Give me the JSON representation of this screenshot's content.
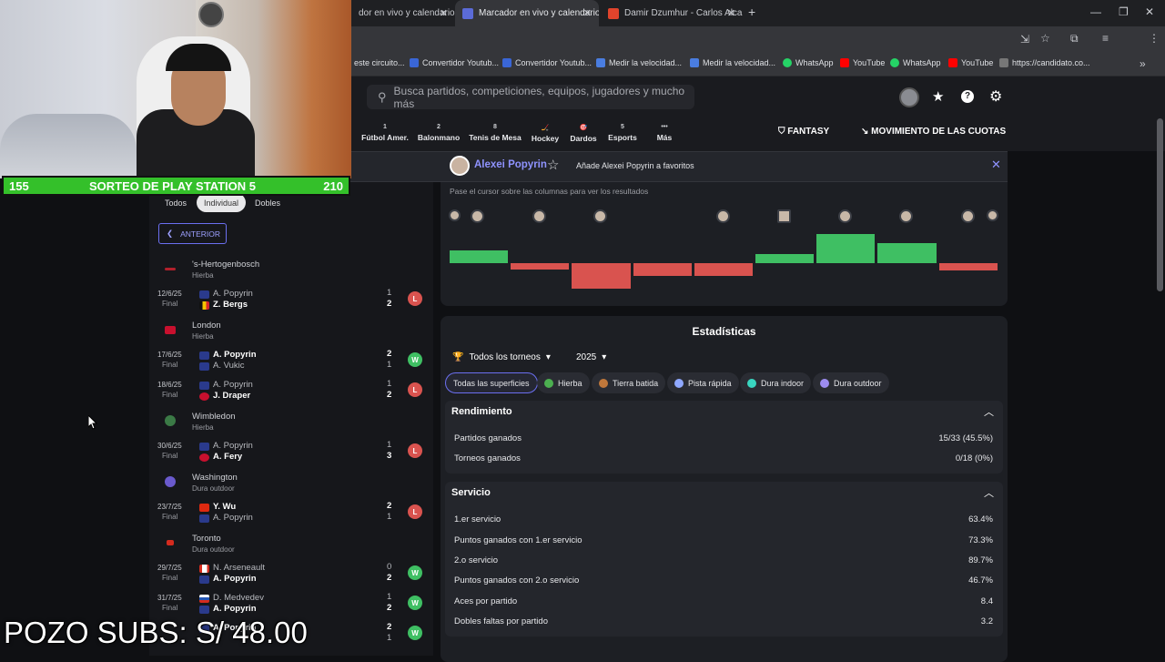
{
  "browser": {
    "tabs": [
      {
        "title": "dor en vivo y calendario",
        "active": false
      },
      {
        "title": "Marcador en vivo y calendario",
        "active": true
      },
      {
        "title": "Damir Dzumhur - Carlos Alcara",
        "active": false
      }
    ],
    "bookmarks": [
      {
        "label": "este circuito...",
        "color": "#35363a"
      },
      {
        "label": "Convertidor Youtub...",
        "color": "#3a66d6"
      },
      {
        "label": "Convertidor Youtub...",
        "color": "#3a66d6"
      },
      {
        "label": "Medir la velocidad...",
        "color": "#4a7de0"
      },
      {
        "label": "Medir la velocidad...",
        "color": "#4a7de0"
      },
      {
        "label": "WhatsApp",
        "color": "#25d366"
      },
      {
        "label": "YouTube",
        "color": "#ff0000"
      },
      {
        "label": "WhatsApp",
        "color": "#25d366"
      },
      {
        "label": "YouTube",
        "color": "#ff0000"
      },
      {
        "label": "https://candidato.co...",
        "color": "#777"
      }
    ]
  },
  "header": {
    "search_placeholder": "Busca partidos, competiciones, equipos, jugadores y mucho más",
    "sports": [
      {
        "num": "1",
        "label": "Fútbol Amer."
      },
      {
        "num": "2",
        "label": "Balonmano"
      },
      {
        "num": "8",
        "label": "Tenis de Mesa"
      },
      {
        "num": "",
        "label": "Hockey"
      },
      {
        "num": "",
        "label": "Dardos"
      },
      {
        "num": "5",
        "label": "Esports"
      },
      {
        "num": "",
        "label": "Más"
      }
    ],
    "fantasy": "FANTASY",
    "odds": "MOVIMIENTO DE LAS CUOTAS"
  },
  "banner": {
    "player": "Alexei Popyrin",
    "fav_text": "Añade Alexei Popyrin a favoritos"
  },
  "filters": {
    "all": "Todos",
    "singles": "Individual",
    "doubles": "Dobles"
  },
  "back_label": "ANTERIOR",
  "matches": {
    "t1": {
      "name": "'s-Hertogenbosch",
      "surface": "Hierba"
    },
    "m1": {
      "date": "12/6/25",
      "status": "Final",
      "p1": "A. Popyrin",
      "p2": "Z. Bergs",
      "s1": "1",
      "s2": "2",
      "result": "L"
    },
    "t2": {
      "name": "London",
      "surface": "Hierba"
    },
    "m2": {
      "date": "17/6/25",
      "status": "Final",
      "p1": "A. Popyrin",
      "p2": "A. Vukic",
      "s1": "2",
      "s2": "1",
      "result": "W"
    },
    "m3": {
      "date": "18/6/25",
      "status": "Final",
      "p1": "A. Popyrin",
      "p2": "J. Draper",
      "s1": "1",
      "s2": "2",
      "result": "L"
    },
    "t3": {
      "name": "Wimbledon",
      "surface": "Hierba"
    },
    "m4": {
      "date": "30/6/25",
      "status": "Final",
      "p1": "A. Popyrin",
      "p2": "A. Fery",
      "s1": "1",
      "s2": "3",
      "result": "L"
    },
    "t4": {
      "name": "Washington",
      "surface": "Dura outdoor"
    },
    "m5": {
      "date": "23/7/25",
      "status": "Final",
      "p1": "Y. Wu",
      "p2": "A. Popyrin",
      "s1": "2",
      "s2": "1",
      "result": "L"
    },
    "t5": {
      "name": "Toronto",
      "surface": "Dura outdoor"
    },
    "m6": {
      "date": "29/7/25",
      "status": "Final",
      "p1": "N. Arseneault",
      "p2": "A. Popyrin",
      "s1": "0",
      "s2": "2",
      "result": "W"
    },
    "m7": {
      "date": "31/7/25",
      "status": "Final",
      "p1": "D. Medvedev",
      "p2": "A. Popyrin",
      "s1": "1",
      "s2": "2",
      "result": "W"
    },
    "m8": {
      "date": "",
      "status": "",
      "p1": "A. Popyrin",
      "p2": "",
      "s1": "2",
      "s2": "1",
      "result": "W"
    }
  },
  "graph": {
    "hint": "Pase el cursor sobre las columnas para ver los resultados",
    "values": [
      1,
      -0.5,
      -2,
      -1,
      -1,
      0.7,
      2.3,
      1.6,
      -0.6
    ]
  },
  "stats": {
    "title": "Estadísticas",
    "tournament_select": "Todos los torneos",
    "year_select": "2025",
    "surfaces": [
      {
        "label": "Todas las superficies",
        "color": ""
      },
      {
        "label": "Hierba",
        "color": "#4caf50"
      },
      {
        "label": "Tierra batida",
        "color": "#c0783b"
      },
      {
        "label": "Pista rápida",
        "color": "#8fa8ff"
      },
      {
        "label": "Dura indoor",
        "color": "#39d5c0"
      },
      {
        "label": "Dura outdoor",
        "color": "#9d8cf0"
      }
    ],
    "rendimiento": {
      "title": "Rendimiento",
      "rows": [
        {
          "label": "Partidos ganados",
          "value": "15/33 (45.5%)"
        },
        {
          "label": "Torneos ganados",
          "value": "0/18 (0%)"
        }
      ]
    },
    "servicio": {
      "title": "Servicio",
      "rows": [
        {
          "label": "1.er servicio",
          "value": "63.4%"
        },
        {
          "label": "Puntos ganados con 1.er servicio",
          "value": "73.3%"
        },
        {
          "label": "2.o servicio",
          "value": "89.7%"
        },
        {
          "label": "Puntos ganados con 2.o servicio",
          "value": "46.7%"
        },
        {
          "label": "Aces por partido",
          "value": "8.4"
        },
        {
          "label": "Dobles faltas por partido",
          "value": "3.2"
        }
      ]
    }
  },
  "overlay": {
    "left_count": "155",
    "title": "SORTEO DE PLAY STATION 5",
    "right_count": "210",
    "pozo": "POZO SUBS: S/ 48.00"
  }
}
